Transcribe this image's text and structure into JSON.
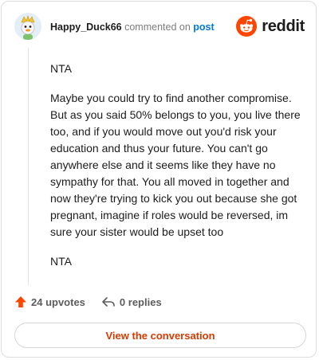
{
  "comment": {
    "username": "Happy_Duck66",
    "action_text": "commented on",
    "post_link": "post",
    "paragraphs": [
      "NTA",
      "Maybe you could try to find another compromise. But as you said 50% belongs to you, you live there too, and if you would move out you'd risk your education and thus your future. You can't go anywhere else and it seems like they have no sympathy for that. You all moved in together and now they're trying to kick you out because she got pregnant, imagine if roles would be reversed, im sure your sister would be upset too",
      "NTA"
    ],
    "upvotes_label": "24 upvotes",
    "replies_label": "0 replies",
    "view_conversation_label": "View the conversation"
  },
  "brand": {
    "wordmark": "reddit",
    "icon": "reddit-alien-icon",
    "color": "#ff4500"
  },
  "icons": {
    "avatar": "duck-avatar-icon",
    "upvote": "upvote-arrow-icon",
    "reply": "reply-arrow-icon"
  },
  "colors": {
    "accent_orange": "#ff4500",
    "cta_text": "#d93a00",
    "link_blue": "#0079d3"
  }
}
